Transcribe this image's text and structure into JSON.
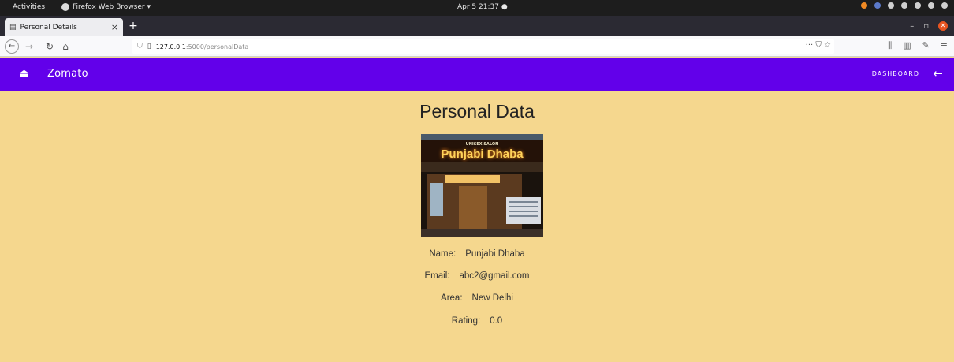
{
  "os": {
    "activities": "Activities",
    "app_menu": "Firefox Web Browser ▾",
    "clock": "Apr 5  21:37  ●"
  },
  "browser": {
    "tab_title": "Personal Details",
    "tab_close": "×",
    "new_tab": "+",
    "url_host": "127.0.0.1",
    "url_path": ":5000/personalData",
    "url_actions": "··· ⛉ ☆"
  },
  "appbar": {
    "brand": "Zomato",
    "dashboard": "DASHBOARD",
    "color": "#6200ea"
  },
  "page": {
    "title": "Personal Data",
    "background": "#f5d78e",
    "photo": {
      "sign_sub": "UNISEX SALON",
      "sign_text": "Punjabi Dhaba"
    },
    "fields": [
      {
        "label": "Name:",
        "value": "Punjabi Dhaba"
      },
      {
        "label": "Email:",
        "value": "abc2@gmail.com"
      },
      {
        "label": "Area:",
        "value": "New Delhi"
      },
      {
        "label": "Rating:",
        "value": "0.0"
      }
    ]
  }
}
